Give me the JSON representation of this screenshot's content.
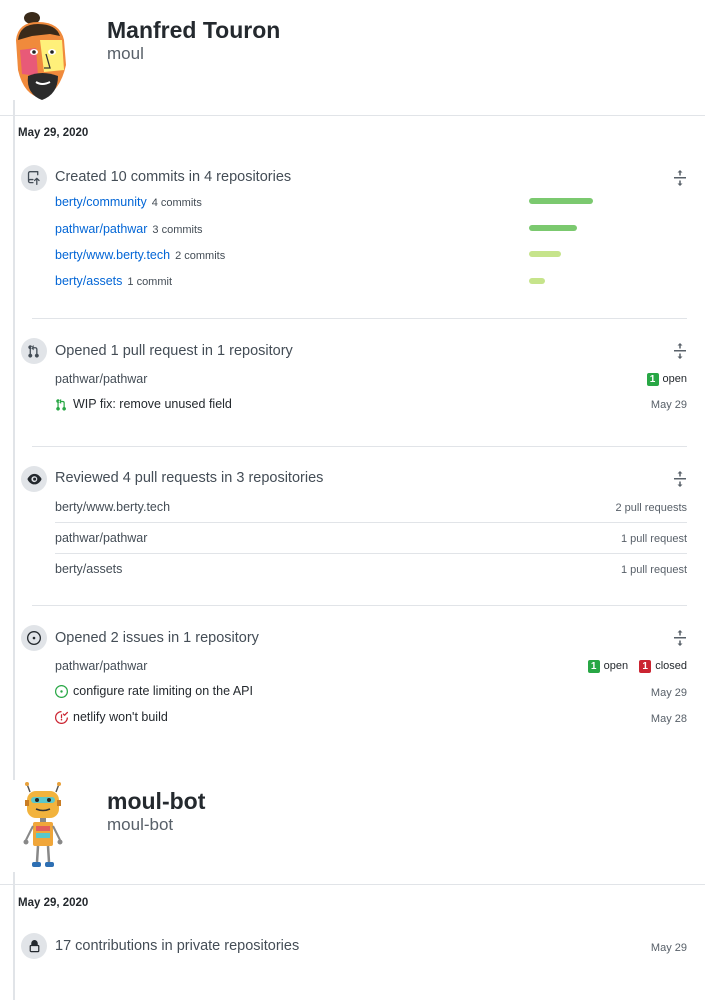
{
  "users": [
    {
      "name": "Manfred Touron",
      "login": "moul",
      "date": "May 29, 2020",
      "commits": {
        "title": "Created 10 commits in 4 repositories",
        "items": [
          {
            "repo": "berty/community",
            "count": "4 commits",
            "value": 4
          },
          {
            "repo": "pathwar/pathwar",
            "count": "3 commits",
            "value": 3
          },
          {
            "repo": "berty/www.berty.tech",
            "count": "2 commits",
            "value": 2
          },
          {
            "repo": "berty/assets",
            "count": "1 commit",
            "value": 1
          }
        ],
        "bar_colors": [
          "#7bc96f",
          "#7bc96f",
          "#c6e48b",
          "#c6e48b"
        ]
      },
      "pull_requests": {
        "title": "Opened 1 pull request in 1 repository",
        "repo": "pathwar/pathwar",
        "open_count": "1",
        "open_label": "open",
        "items": [
          {
            "title": "WIP fix: remove unused field",
            "date": "May 29"
          }
        ]
      },
      "reviews": {
        "title": "Reviewed 4 pull requests in 3 repositories",
        "items": [
          {
            "repo": "berty/www.berty.tech",
            "count": "2 pull requests"
          },
          {
            "repo": "pathwar/pathwar",
            "count": "1 pull request"
          },
          {
            "repo": "berty/assets",
            "count": "1 pull request"
          }
        ]
      },
      "issues": {
        "title": "Opened 2 issues in 1 repository",
        "repo": "pathwar/pathwar",
        "open_count": "1",
        "open_label": "open",
        "closed_count": "1",
        "closed_label": "closed",
        "items": [
          {
            "title": "configure rate limiting on the API",
            "date": "May 29",
            "state": "open"
          },
          {
            "title": "netlify won't build",
            "date": "May 28",
            "state": "closed"
          }
        ]
      }
    },
    {
      "name": "moul-bot",
      "login": "moul-bot",
      "date": "May 29, 2020",
      "private": {
        "title": "17 contributions in private repositories",
        "date": "May 29"
      }
    }
  ],
  "colors": {
    "link": "#0366d6",
    "open_green": "#28a745",
    "closed_red": "#cb2431",
    "bar_dark": "#7bc96f",
    "bar_light": "#c6e48b"
  },
  "icons": [
    "moul-avatar",
    "moul-bot-avatar",
    "repo-push-icon",
    "git-pull-request-icon",
    "eye-icon",
    "issue-opened-icon",
    "issue-closed-icon",
    "lock-icon",
    "fold-icon"
  ]
}
